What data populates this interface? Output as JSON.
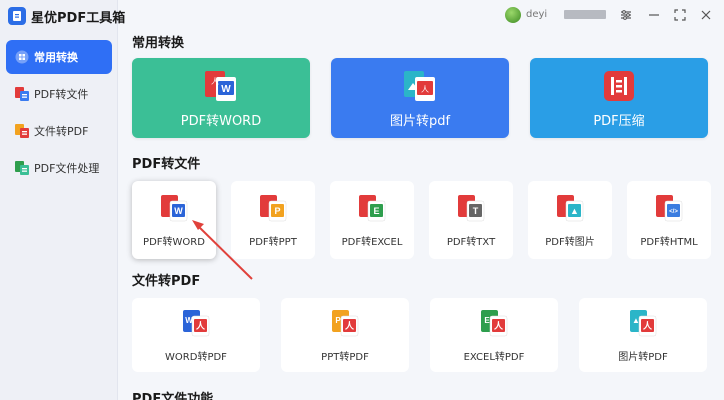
{
  "app": {
    "name": "星优PDF工具箱"
  },
  "sidebar": {
    "items": [
      {
        "label": "常用转换",
        "icon": "grid-icon",
        "active": true
      },
      {
        "label": "PDF转文件",
        "icon": "pdf-to-file-icon",
        "active": false
      },
      {
        "label": "文件转PDF",
        "icon": "file-to-pdf-icon",
        "active": false
      },
      {
        "label": "PDF文件处理",
        "icon": "pdf-process-icon",
        "active": false
      }
    ]
  },
  "topbar": {
    "user_id": "deyi"
  },
  "common": {
    "title": "常用转换",
    "cards": [
      {
        "label": "PDF转WORD",
        "color": "#3bbf96",
        "icon": "pdf-word-icon"
      },
      {
        "label": "图片转pdf",
        "color": "#3a7bf0",
        "icon": "image-pdf-icon"
      },
      {
        "label": "PDF压缩",
        "color": "#2a9ee6",
        "icon": "pdf-compress-icon"
      }
    ]
  },
  "pdf_to_file": {
    "title": "PDF转文件",
    "cards": [
      {
        "label": "PDF转WORD",
        "badge": "W",
        "badge_color": "#2b64d8"
      },
      {
        "label": "PDF转PPT",
        "badge": "P",
        "badge_color": "#f2a21f"
      },
      {
        "label": "PDF转EXCEL",
        "badge": "E",
        "badge_color": "#2e9e4d"
      },
      {
        "label": "PDF转TXT",
        "badge": "T",
        "badge_color": "#666666"
      },
      {
        "label": "PDF转图片",
        "badge": "▲",
        "badge_color": "#2bb5c8"
      },
      {
        "label": "PDF转HTML",
        "badge": "</>",
        "badge_color": "#3b7de0"
      }
    ]
  },
  "file_to_pdf": {
    "title": "文件转PDF",
    "cards": [
      {
        "label": "WORD转PDF",
        "badge": "W",
        "badge_color": "#2b64d8"
      },
      {
        "label": "PPT转PDF",
        "badge": "P",
        "badge_color": "#f2a21f"
      },
      {
        "label": "EXCEL转PDF",
        "badge": "E",
        "badge_color": "#2e9e4d"
      },
      {
        "label": "图片转PDF",
        "badge": "▲",
        "badge_color": "#2bb5c8"
      }
    ]
  },
  "pdf_functions": {
    "title": "PDF文件功能"
  },
  "colors": {
    "accent": "#2f6ff5",
    "pdf_red": "#e23b3b"
  }
}
